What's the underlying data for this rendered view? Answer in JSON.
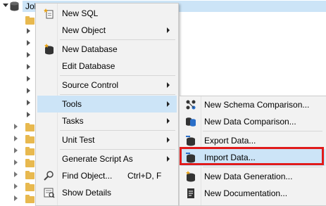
{
  "tree": {
    "root_label": "Job",
    "icons": {
      "root": "database-icon",
      "folder": "folder-icon"
    }
  },
  "menu": {
    "items": [
      {
        "label": "New SQL",
        "icon": "new-sql-icon",
        "submenu": false
      },
      {
        "label": "New Object",
        "icon": "",
        "submenu": true
      },
      {
        "label": "New Database",
        "icon": "new-database-icon",
        "submenu": false
      },
      {
        "label": "Edit Database",
        "icon": "",
        "submenu": false
      },
      {
        "label": "Source Control",
        "icon": "",
        "submenu": true
      },
      {
        "label": "Tools",
        "icon": "",
        "submenu": true,
        "highlighted": true
      },
      {
        "label": "Tasks",
        "icon": "",
        "submenu": true
      },
      {
        "label": "Unit Test",
        "icon": "",
        "submenu": true
      },
      {
        "label": "Generate Script As",
        "icon": "",
        "submenu": true
      },
      {
        "label": "Find Object...",
        "shortcut": "Ctrl+D, F",
        "icon": "find-object-icon",
        "submenu": false
      },
      {
        "label": "Show Details",
        "icon": "show-details-icon",
        "submenu": false
      }
    ]
  },
  "tools_submenu": {
    "items": [
      {
        "label": "New Schema Comparison...",
        "icon": "schema-compare-icon"
      },
      {
        "label": "New Data Comparison...",
        "icon": "data-compare-icon"
      },
      {
        "label": "Export Data...",
        "icon": "export-data-icon"
      },
      {
        "label": "Import Data...",
        "icon": "import-data-icon",
        "highlighted": true
      },
      {
        "label": "New Data Generation...",
        "icon": "data-generation-icon"
      },
      {
        "label": "New Documentation...",
        "icon": "documentation-icon"
      }
    ]
  },
  "colors": {
    "highlight": "#cce4f7",
    "menu_bg": "#f2f2f2",
    "callout_border": "#e01b1b",
    "folder": "#e8b94f"
  }
}
